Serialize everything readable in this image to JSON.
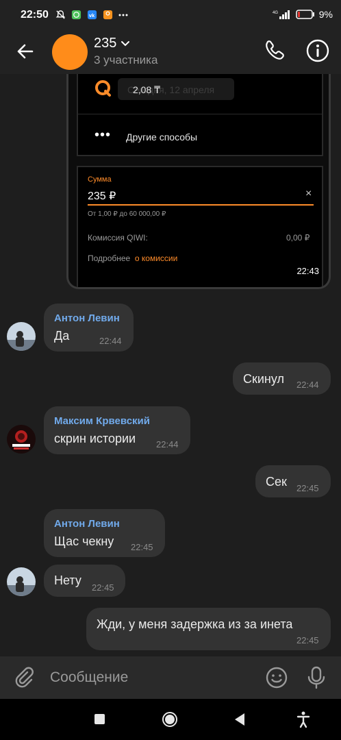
{
  "status_bar": {
    "time": "22:50",
    "battery": "9%",
    "network": "4G",
    "icons": [
      "mute-bell-icon",
      "whatsapp-icon",
      "vk-icon",
      "ok-icon",
      "more-icon"
    ]
  },
  "header": {
    "title": "235",
    "subtitle": "3 участника"
  },
  "shared_image": {
    "date_chip": "Сегодня, 12 апреля",
    "amount_row": "2,08 ₸",
    "other_methods": "Другие способы",
    "sum_label": "Сумма",
    "sum_value": "235 ₽",
    "clear": "×",
    "range": "От 1,00 ₽ до 60 000,00 ₽",
    "fee_label": "Комиссия QIWI:",
    "fee_value": "0,00 ₽",
    "more_prefix": "Подробнее",
    "more_link": "о комиссии",
    "time": "22:43"
  },
  "messages": [
    {
      "sender": "Антон Левин",
      "text": "Да",
      "time": "22:44",
      "incoming": true
    },
    {
      "sender": "",
      "text": "Скинул",
      "time": "22:44",
      "incoming": false
    },
    {
      "sender": "Максим Крвевский",
      "text": "скрин истории",
      "time": "22:44",
      "incoming": true
    },
    {
      "sender": "",
      "text": "Сек",
      "time": "22:45",
      "incoming": false
    },
    {
      "sender": "Антон Левин",
      "text": "Щас чекну",
      "time": "22:45",
      "incoming": true
    },
    {
      "sender": "",
      "text": "Нету",
      "time": "22:45",
      "incoming": true
    },
    {
      "sender": "",
      "text": "Жди, у меня задержка из за инета",
      "time": "22:45",
      "incoming": false
    }
  ],
  "composer": {
    "placeholder": "Сообщение"
  },
  "colors": {
    "accent_blue": "#71aaeb",
    "qiwi_orange": "#ff8c2a",
    "bubble": "#333333",
    "background": "#1e1e1e"
  }
}
